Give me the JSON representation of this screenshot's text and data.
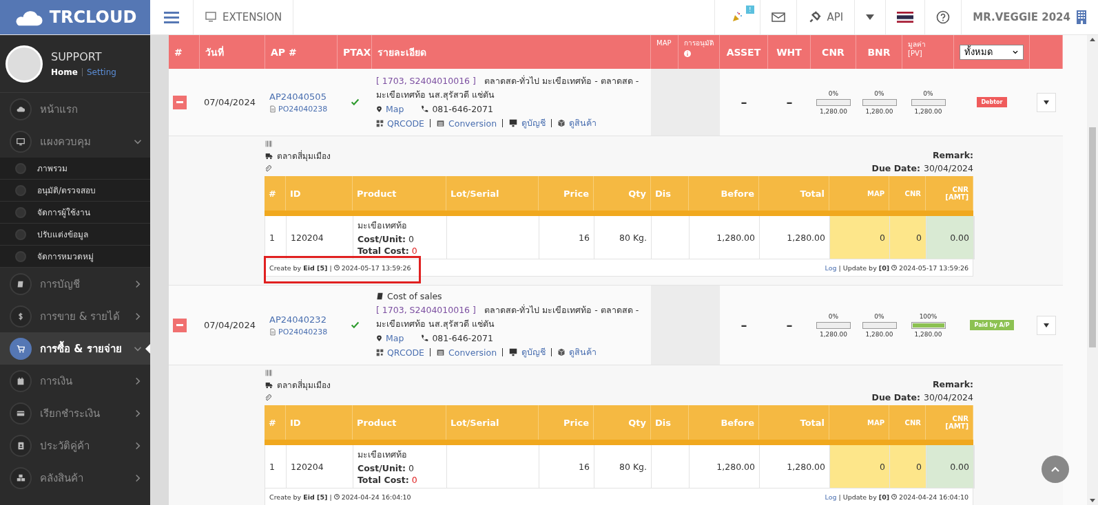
{
  "topbar": {
    "logo": "TRCLOUD",
    "extension": "EXTENSION",
    "notification_badge": "!",
    "api": "API",
    "company": "MR.VEGGIE 2024"
  },
  "profile": {
    "name": "SUPPORT",
    "links": [
      {
        "label": "Home",
        "selected": true
      },
      {
        "label": "Setting",
        "selected": false
      }
    ]
  },
  "menu": [
    {
      "kind": "link",
      "label": "หน้าแรก",
      "selected": false
    },
    {
      "kind": "group",
      "label": "แผงควบคุม",
      "selected": false,
      "expanded": true
    },
    {
      "kind": "sub",
      "label": "ภาพรวม",
      "selected": false
    },
    {
      "kind": "sub",
      "label": "อนุมัติ/ตรวจสอบ",
      "selected": false
    },
    {
      "kind": "sub",
      "label": "จัดการผู้ใช้งาน",
      "selected": false
    },
    {
      "kind": "sub",
      "label": "ปรับแต่งข้อมูล",
      "selected": false
    },
    {
      "kind": "sub",
      "label": "จัดการหมวดหมู่",
      "selected": false
    },
    {
      "kind": "group",
      "label": "การบัญชี",
      "selected": false,
      "expanded": false
    },
    {
      "kind": "group",
      "label": "การขาย & รายได้",
      "selected": false,
      "expanded": false
    },
    {
      "kind": "group",
      "label": "การซื้อ & รายจ่าย",
      "selected": true,
      "expanded": true
    },
    {
      "kind": "group",
      "label": "การเงิน",
      "selected": false,
      "expanded": false
    },
    {
      "kind": "group",
      "label": "เรียกชำระเงิน",
      "selected": false,
      "expanded": false
    },
    {
      "kind": "group",
      "label": "ประวัติคู่ค้า",
      "selected": false,
      "expanded": false
    },
    {
      "kind": "group",
      "label": "คลังสินค้า",
      "selected": false,
      "expanded": false
    }
  ],
  "table": {
    "columns": [
      {
        "label": "#",
        "kind": "text"
      },
      {
        "label": "วันที่",
        "kind": "text"
      },
      {
        "label": "AP #",
        "kind": "text"
      },
      {
        "label": "PTAX",
        "kind": "text"
      },
      {
        "label": "รายละเอียด",
        "kind": "text"
      },
      {
        "label": "MAP",
        "kind": "small"
      },
      {
        "label": "การอนุมัติ",
        "kind": "info"
      },
      {
        "label": "ASSET",
        "kind": "center"
      },
      {
        "label": "WHT",
        "kind": "center"
      },
      {
        "label": "CNR",
        "kind": "center"
      },
      {
        "label": "BNR",
        "kind": "center"
      },
      {
        "label": "มูลค่า [PV]",
        "kind": "small"
      },
      {
        "label": "ทั้งหมด",
        "kind": "select"
      }
    ],
    "records": [
      {
        "expanded": true,
        "date": "07/04/2024",
        "ap": "AP24040505",
        "po": "PO24040238",
        "ptax": true,
        "ref": "[ 1703, S2404010016 ]",
        "description": "ตลาดสด-ทั่วไป มะเขือเทศท้อ - ตลาดสด - มะเขือเทศท้อ นส.สุรัสวดี แช่ตัน",
        "map": "Map",
        "phone": "081-646-2071",
        "links": [
          "QRCODE",
          "Conversion",
          "ดูบัญชี",
          "ดูสินค้า"
        ],
        "asset": "–",
        "wht": "–",
        "progress": [
          {
            "percent": "0%",
            "level": 0,
            "amount": "1,280.00"
          },
          {
            "percent": "0%",
            "level": 0,
            "amount": "1,280.00"
          },
          {
            "percent": "0%",
            "level": 0,
            "amount": "1,280.00"
          }
        ],
        "status": {
          "label": "Debtor",
          "color": "#ef5b5b"
        },
        "detail": {
          "vendor": "ตลาดสี่มุมเมือง",
          "remark": "Remark:",
          "due_label": "Due Date:",
          "due": "30/04/2024",
          "columns": [
            "#",
            "ID",
            "Product",
            "Lot/Serial",
            "Price",
            "Qty",
            "Dis",
            "Before",
            "Total",
            "MAP",
            "CNR",
            "CNR [AMT]"
          ],
          "lines": [
            {
              "no": "1",
              "id": "120204",
              "product": "มะเขือเทศท้อ",
              "cost_unit_label": "Cost/Unit:",
              "cost_unit": "0",
              "total_cost_label": "Total Cost:",
              "total_cost": "0",
              "price": "16",
              "qty": "80 Kg.",
              "before": "1,280.00",
              "total": "1,280.00",
              "map": "0",
              "cnr": "0",
              "cnr_amt": "0.00"
            }
          ],
          "footer": {
            "created": "Create by **Eid [5]** |",
            "created_at": "2024-05-17 13:59:26",
            "log": "Log",
            "updated": "| Update by **[0]**",
            "updated_at": "2024-05-17 13:59:26",
            "highlighted": true
          }
        }
      },
      {
        "expanded": true,
        "date": "07/04/2024",
        "ap": "AP24040232",
        "po": "PO24040238",
        "ptax": true,
        "category": "Cost of sales",
        "ref": "[ 1703, S2404010016 ]",
        "description": "ตลาดสด-ทั่วไป มะเขือเทศท้อ - ตลาดสด - มะเขือเทศท้อ นส.สุรัสวดี แช่ตัน",
        "map": "Map",
        "phone": "081-646-2071",
        "links": [
          "QRCODE",
          "Conversion",
          "ดูบัญชี",
          "ดูสินค้า"
        ],
        "asset": "–",
        "wht": "–",
        "progress": [
          {
            "percent": "0%",
            "level": 0,
            "amount": "1,280.00"
          },
          {
            "percent": "0%",
            "level": 0,
            "amount": "1,280.00"
          },
          {
            "percent": "100%",
            "level": 1,
            "amount": "1,280.00"
          }
        ],
        "status": {
          "label": "Paid by A/P",
          "color": "#8cc152"
        },
        "detail": {
          "vendor": "ตลาดสี่มุมเมือง",
          "remark": "Remark:",
          "due_label": "Due Date:",
          "due": "30/04/2024",
          "columns": [
            "#",
            "ID",
            "Product",
            "Lot/Serial",
            "Price",
            "Qty",
            "Dis",
            "Before",
            "Total",
            "MAP",
            "CNR",
            "CNR [AMT]"
          ],
          "lines": [
            {
              "no": "1",
              "id": "120204",
              "product": "มะเขือเทศท้อ",
              "cost_unit_label": "Cost/Unit:",
              "cost_unit": "0",
              "total_cost_label": "Total Cost:",
              "total_cost": "0",
              "price": "16",
              "qty": "80 Kg.",
              "before": "1,280.00",
              "total": "1,280.00",
              "map": "0",
              "cnr": "0",
              "cnr_amt": "0.00"
            }
          ],
          "footer": {
            "created": "Create by **Eid [5]** |",
            "created_at": "2024-04-24 16:04:10",
            "log": "Log",
            "updated": "| Update by **[0]**",
            "updated_at": "2024-04-24 16:04:10",
            "highlighted": false
          }
        }
      }
    ]
  }
}
